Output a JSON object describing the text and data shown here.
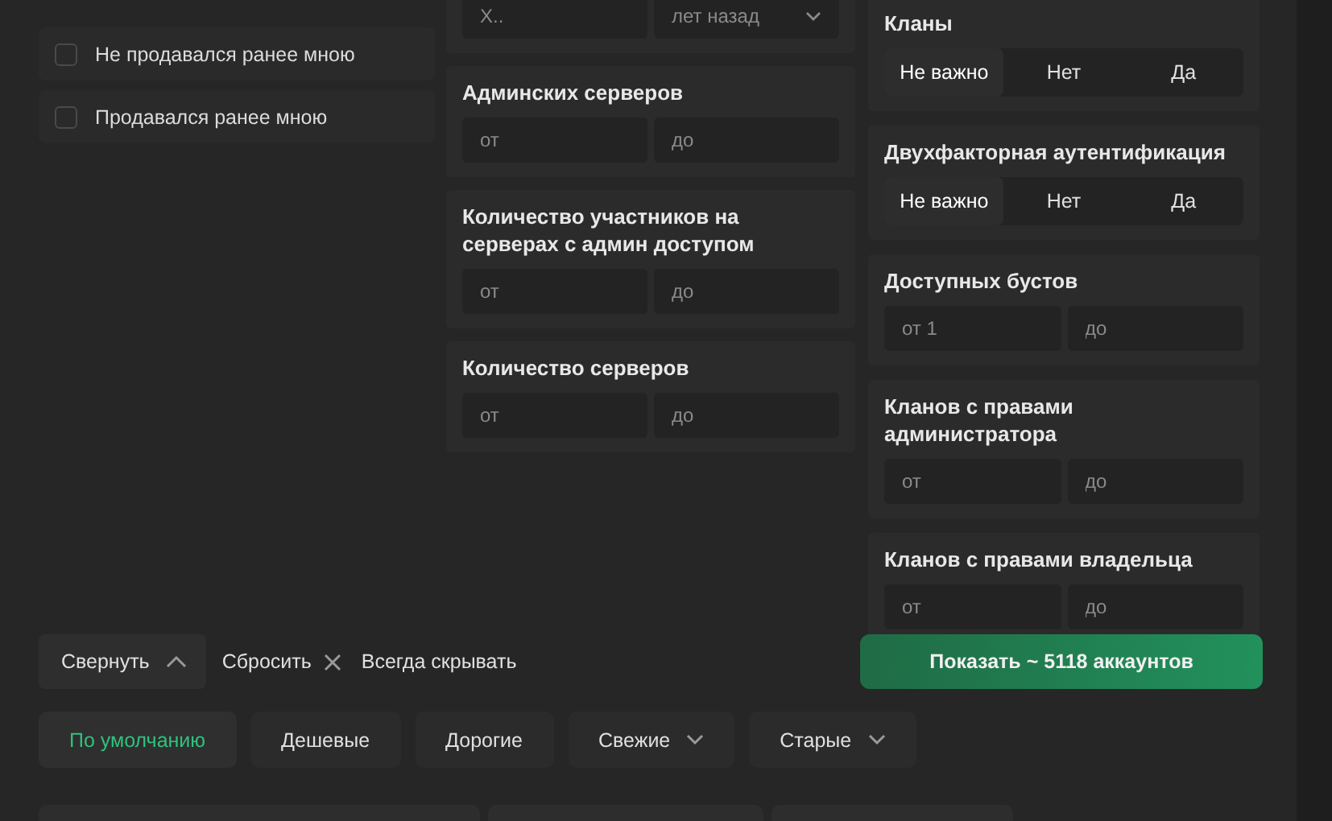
{
  "checkbox_options": [
    {
      "label": "Не продавался ранее мною",
      "checked": false
    },
    {
      "label": "Продавался ранее мною",
      "checked": false
    }
  ],
  "middle_filters": [
    {
      "kind": "range",
      "fields": [
        {
          "kind": "input",
          "placeholder": "Х.."
        },
        {
          "kind": "select",
          "value": "лет назад"
        }
      ]
    },
    {
      "kind": "range",
      "title": "Админских серверов",
      "fields": [
        {
          "kind": "input",
          "placeholder": "от"
        },
        {
          "kind": "input",
          "placeholder": "до"
        }
      ]
    },
    {
      "kind": "range",
      "title": "Количество участников на серверах с админ доступом",
      "fields": [
        {
          "kind": "input",
          "placeholder": "от"
        },
        {
          "kind": "input",
          "placeholder": "до"
        }
      ]
    },
    {
      "kind": "range",
      "title": "Количество серверов",
      "fields": [
        {
          "kind": "input",
          "placeholder": "от"
        },
        {
          "kind": "input",
          "placeholder": "до"
        }
      ]
    }
  ],
  "right_filters": [
    {
      "kind": "toggle",
      "title": "Кланы",
      "options": [
        {
          "label": "Не важно",
          "selected": true
        },
        {
          "label": "Нет",
          "selected": false
        },
        {
          "label": "Да",
          "selected": false
        }
      ]
    },
    {
      "kind": "toggle",
      "title": "Двухфакторная аутентификация",
      "options": [
        {
          "label": "Не важно",
          "selected": true
        },
        {
          "label": "Нет",
          "selected": false
        },
        {
          "label": "Да",
          "selected": false
        }
      ]
    },
    {
      "kind": "range",
      "title": "Доступных бустов",
      "fields": [
        {
          "kind": "input",
          "placeholder": "от 1"
        },
        {
          "kind": "input",
          "placeholder": "до"
        }
      ]
    },
    {
      "kind": "range",
      "title": "Кланов с правами администратора",
      "fields": [
        {
          "kind": "input",
          "placeholder": "от"
        },
        {
          "kind": "input",
          "placeholder": "до"
        }
      ]
    },
    {
      "kind": "range",
      "title": "Кланов с правами владельца",
      "fields": [
        {
          "kind": "input",
          "placeholder": "от"
        },
        {
          "kind": "input",
          "placeholder": "до"
        }
      ]
    }
  ],
  "actions": {
    "collapse": {
      "label": "Свернуть",
      "expanded": true
    },
    "reset": "Сбросить",
    "always_hide": "Всегда скрывать",
    "show_button": "Показать ~ 5118 аккаунтов"
  },
  "sort_options": [
    {
      "label": "По умолчанию",
      "selected": true,
      "dropdown": false
    },
    {
      "label": "Дешевые",
      "selected": false,
      "dropdown": false
    },
    {
      "label": "Дорогие",
      "selected": false,
      "dropdown": false
    },
    {
      "label": "Свежие",
      "selected": false,
      "dropdown": true
    },
    {
      "label": "Старые",
      "selected": false,
      "dropdown": true
    }
  ]
}
